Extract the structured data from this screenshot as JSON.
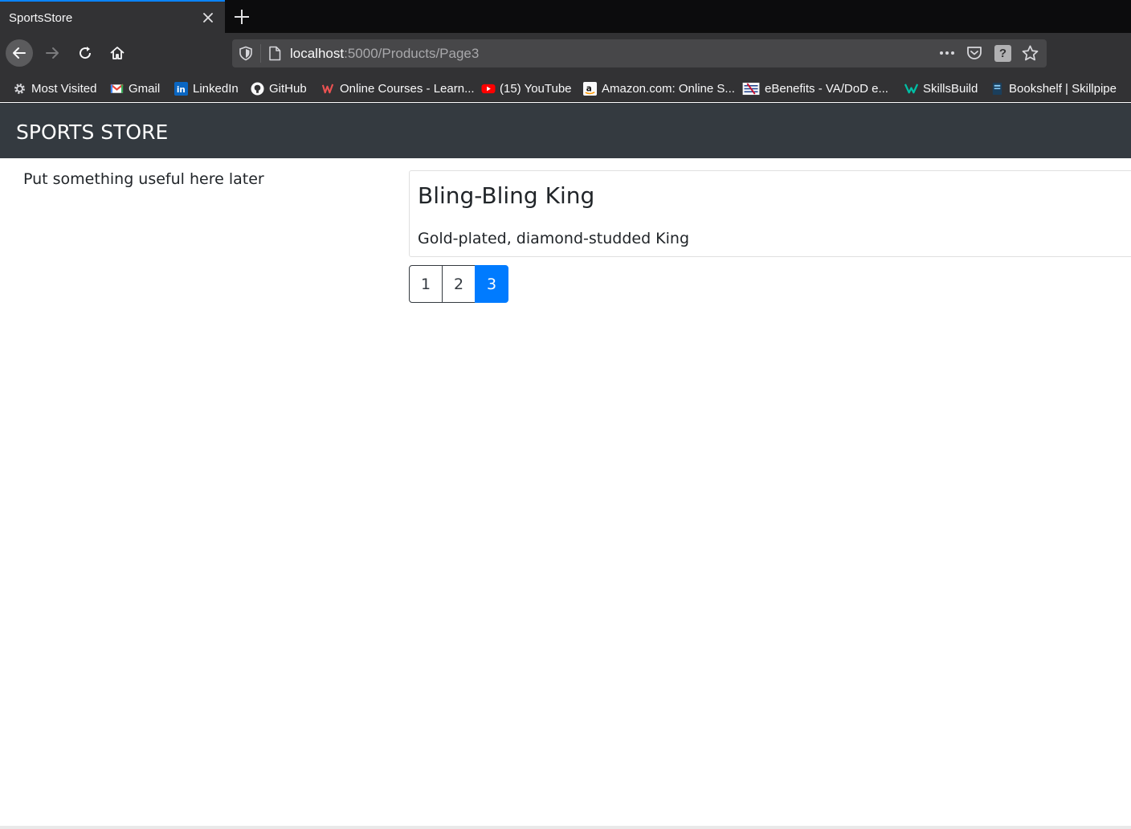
{
  "browser": {
    "tab_title": "SportsStore",
    "url_host": "localhost",
    "url_rest": ":5000/Products/Page3",
    "bookmarks": [
      {
        "label": "Most Visited",
        "icon": "gear-icon"
      },
      {
        "label": "Gmail",
        "icon": "gmail-icon"
      },
      {
        "label": "LinkedIn",
        "icon": "linkedin-icon"
      },
      {
        "label": "GitHub",
        "icon": "github-icon"
      },
      {
        "label": "Online Courses - Learn...",
        "icon": "udemy-icon"
      },
      {
        "label": "(15) YouTube",
        "icon": "youtube-icon"
      },
      {
        "label": "Amazon.com: Online S...",
        "icon": "amazon-icon"
      },
      {
        "label": "eBenefits - VA/DoD e...",
        "icon": "ebenefits-icon"
      },
      {
        "label": "SkillsBuild",
        "icon": "skillsbuild-icon"
      },
      {
        "label": "Bookshelf | Skillpipe",
        "icon": "bookshelf-icon"
      }
    ]
  },
  "app": {
    "brand": "SPORTS STORE",
    "sidebar_text": "Put something useful here later",
    "product": {
      "name": "Bling-Bling King",
      "description": "Gold-plated, diamond-studded King"
    },
    "pages": [
      "1",
      "2",
      "3"
    ],
    "current_page": "3"
  },
  "colors": {
    "header_bg": "#343a40",
    "active_page": "#007bff"
  }
}
